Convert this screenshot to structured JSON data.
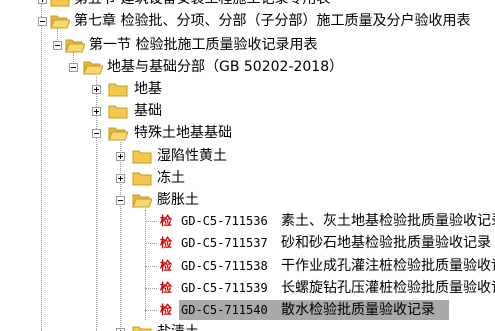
{
  "tree": {
    "items": [
      {
        "label": "第五节  建筑设备安装工程施工记录专用表",
        "expanded": false
      },
      {
        "label": "第七章  检验批、分项、分部（子分部）施工质量及分户验收用表",
        "expanded": true
      },
      {
        "label": "第一节  检验批施工质量验收记录用表",
        "expanded": true
      },
      {
        "label": "地基与基础分部（GB 50202-2018）",
        "expanded": true
      },
      {
        "label": "地基",
        "expanded": false
      },
      {
        "label": "基础",
        "expanded": false
      },
      {
        "label": "特殊土地基基础",
        "expanded": true
      },
      {
        "label": "湿陷性黄土",
        "expanded": false
      },
      {
        "label": "冻土",
        "expanded": false
      },
      {
        "label": "膨胀土",
        "expanded": true
      },
      {
        "badge": "检",
        "code": "GD-C5-711536",
        "label": "素土、灰土地基检验批质量验收记录"
      },
      {
        "badge": "检",
        "code": "GD-C5-711537",
        "label": "砂和砂石地基检验批质量验收记录"
      },
      {
        "badge": "检",
        "code": "GD-C5-711538",
        "label": "干作业成孔灌注桩检验批质量验收记录"
      },
      {
        "badge": "检",
        "code": "GD-C5-711539",
        "label": "长螺旋钻孔压灌桩检验批质量验收记录"
      },
      {
        "badge": "检",
        "code": "GD-C5-711540",
        "label": "散水检验批质量验收记录",
        "selected": true
      },
      {
        "label": "盐渍土",
        "expanded": false
      }
    ]
  },
  "colors": {
    "folder": "#f2c94c",
    "folder_dark": "#c99a1b",
    "badge": "#d40000",
    "selection": "#a9a9a9"
  }
}
